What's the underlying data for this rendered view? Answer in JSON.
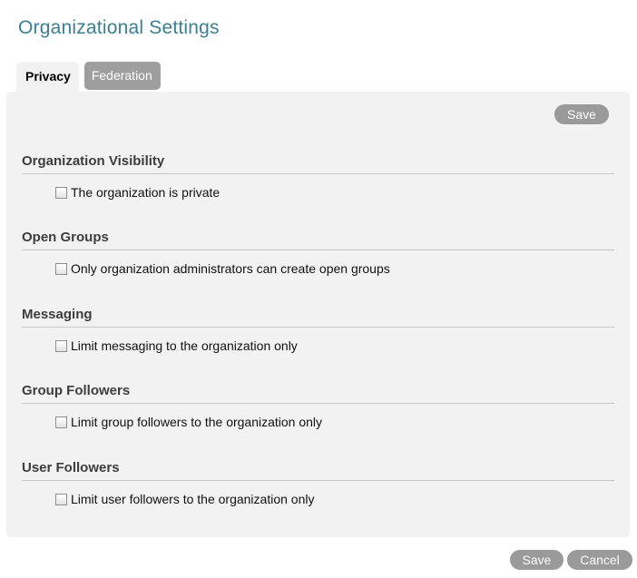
{
  "page": {
    "title": "Organizational Settings"
  },
  "tabs": [
    {
      "label": "Privacy",
      "active": true
    },
    {
      "label": "Federation",
      "active": false
    }
  ],
  "panel": {
    "save_label": "Save",
    "sections": [
      {
        "title": "Organization Visibility",
        "option": "The organization is private",
        "checked": false
      },
      {
        "title": "Open Groups",
        "option": "Only organization administrators can create open groups",
        "checked": false
      },
      {
        "title": "Messaging",
        "option": "Limit messaging to the organization only",
        "checked": false
      },
      {
        "title": "Group Followers",
        "option": "Limit group followers to the organization only",
        "checked": false
      },
      {
        "title": "User Followers",
        "option": "Limit user followers to the organization only",
        "checked": false
      }
    ]
  },
  "footer": {
    "save_label": "Save",
    "cancel_label": "Cancel"
  },
  "colors": {
    "title": "#3b7f93",
    "panel_background": "#f2f2f2",
    "button_background": "#9a9a9a",
    "inactive_tab": "#9e9e9e"
  }
}
